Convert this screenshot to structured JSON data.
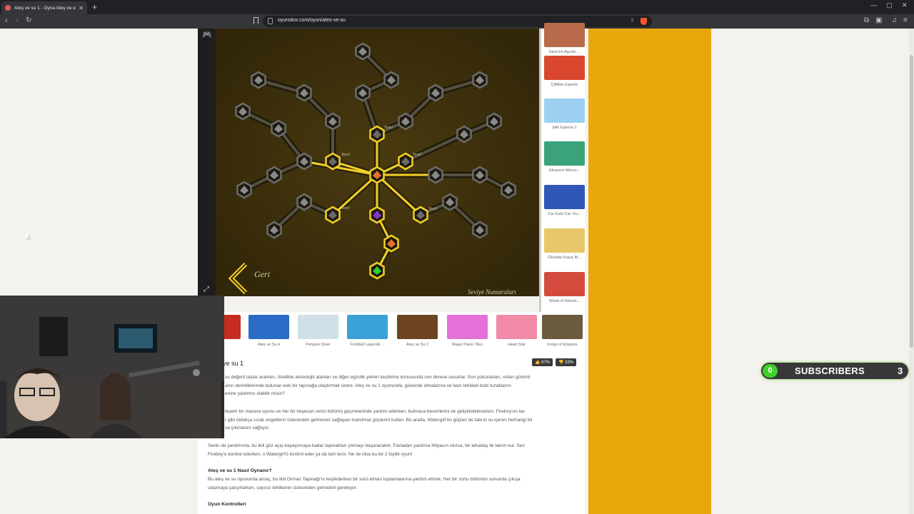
{
  "browser": {
    "tab_title": "Ateş ve su 1 - Oyna Ateş ve su 1",
    "tab_close": "✕",
    "new_tab": "+",
    "url": "oyunskor.com/oyun/ates-ve-su",
    "window_min": "—",
    "window_max": "▢",
    "window_close": "✕"
  },
  "game": {
    "back_label": "Geri",
    "level_numbers_label": "Seviye Numaraları",
    "new_label": "Yeni!"
  },
  "sidebar": {
    "items": [
      {
        "label": "Sara'nın Aşçılık ...",
        "color": "#b86a4a"
      },
      {
        "label": "Çiftlikte Eşleme",
        "color": "#d9472f"
      },
      {
        "label": "İplik Eşleme 2",
        "color": "#9bd0f0"
      },
      {
        "label": "Efsanevi Mücev...",
        "color": "#3aa37a"
      },
      {
        "label": "Car Eats Car: Ku...",
        "color": "#2f57b8"
      },
      {
        "label": "Okuldan Kaçış M...",
        "color": "#e8c76a"
      },
      {
        "label": "World of Warshi...",
        "color": "#d34b3c"
      }
    ]
  },
  "strip": {
    "items": [
      {
        "label": "u 5",
        "color": "#c62c20"
      },
      {
        "label": "Ateş ve Su 4",
        "color": "#2a6cc7"
      },
      {
        "label": "Penguin Diner",
        "color": "#cfe0e6"
      },
      {
        "label": "Football Legends ...",
        "color": "#3aa0d8"
      },
      {
        "label": "Ateş ve Su 2",
        "color": "#6c4421"
      },
      {
        "label": "Magic Piano Tiles",
        "color": "#e470d8"
      },
      {
        "label": "Heart Star",
        "color": "#f08aa6"
      },
      {
        "label": "Forge of Empires",
        "color": "#6a5a3e"
      }
    ]
  },
  "article": {
    "title": "ve su 1",
    "upvote": "👍 67%",
    "downvote": "👎 33%",
    "p1_lines": [
      "su değerli taşlar ararken, özellikle arkeolojik alanları ve diğer egzotik yerleri keşfetme konusunda son derece cesurlar. Son yolculukları, onları gizemli",
      "anın derinliklerinde bulunan eski bir tapınağa ulaştırmak üzere. Ateş ve su 1 oyununda, güvende olmalarına ve bazı tehlikeli bubi tuzaklarını",
      "enine yardımcı olabilir misin?"
    ],
    "p2_lines": [
      "teşem bir macera oyunu ve her bir heyecan verici bölümü geçmelerinde yardım ederken, bulmaca becerilerini de geliştirebileceksin. Fireboy'un lav",
      "r gibi oldukça sıcak engellerin üstesinden gelmesini sağlayan inanılmaz güçlerini kullan. Bu arada, Watergirl'ün güçleri de tabi ki su içeren herhangi bir",
      "sa çıkmasını sağlıyor."
    ],
    "p3_lines": [
      "Senin de yardımınla, bu ikili göz açıp kapayıncaya kadar tapınaktan çıkmayı başaracaktır. Fazladan yardıma ihtiyacın olursa, bir arkadaş ile takım kur. Sen",
      "Fireboy'u kontrol ederken, o Watergirl'ü kontrol eder ya da tam tersi. Ne de olsa bu bir 2 kişilik oyun!"
    ],
    "h_howto": "Ateş ve su 1 Nasıl Oynanır?",
    "p4_lines": [
      "Bu ateş ve su oyununda amaç, bu ikili Orman Tapınağı'nı keşfederken bir sürü elmas toplamalarına yardım etmek. Her bir zorlu bölümün sonunda çıkışa",
      "ulaşmaya çalışırlarken, sayısız tehlikenin üstesinden gelmeleri gerekiyor."
    ],
    "h_controls": "Oyun Kontrolleri"
  },
  "subscribers": {
    "count": "0",
    "label": "SUBSCRIBERS",
    "goal": "3"
  },
  "colors": {
    "game_bg": "#3a2e0b",
    "node_gray": "#6c6c6c",
    "node_gold": "#f2d026",
    "fire": "#e8722a",
    "water_exit": "#8a33c9",
    "green": "#2fcf2f",
    "yellow_panel": "#eaa70b",
    "subscriber_green": "#3ed12a"
  }
}
